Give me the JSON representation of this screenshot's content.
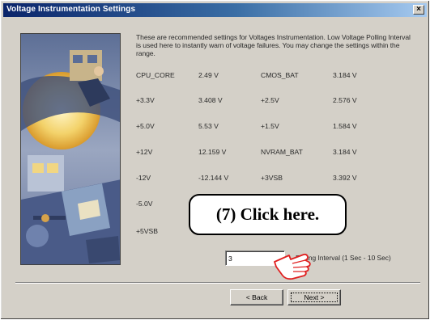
{
  "window": {
    "title": "Voltage Instrumentation Settings",
    "close_glyph": "×"
  },
  "description": "These are recommended settings for Voltages Instrumentation. Low Voltage Polling Interval is used here to instantly warn of voltage failures. You may change the settings within the range.",
  "readings": [
    {
      "left_label": "CPU_CORE",
      "left_value": "2.49 V",
      "right_label": "CMOS_BAT",
      "right_value": "3.184 V"
    },
    {
      "left_label": "+3.3V",
      "left_value": "3.408 V",
      "right_label": "+2.5V",
      "right_value": "2.576 V"
    },
    {
      "left_label": "+5.0V",
      "left_value": "5.53 V",
      "right_label": "+1.5V",
      "right_value": "1.584 V"
    },
    {
      "left_label": "+12V",
      "left_value": "12.159 V",
      "right_label": "NVRAM_BAT",
      "right_value": "3.184 V"
    },
    {
      "left_label": "-12V",
      "left_value": "-12.144 V",
      "right_label": "+3VSB",
      "right_value": "3.392 V"
    },
    {
      "left_label": "-5.0V",
      "left_value": "",
      "right_label": "",
      "right_value": ""
    },
    {
      "left_label": "+5VSB",
      "left_value": "",
      "right_label": "",
      "right_value": ""
    }
  ],
  "polling": {
    "value": "3",
    "label": "Polling Interval (1 Sec - 10 Sec)"
  },
  "buttons": {
    "back": "< Back",
    "next": "Next >"
  },
  "annotation": {
    "callout": "(7)  Click here."
  },
  "icons": {
    "close": "close-icon",
    "hand": "pointing-hand-icon"
  },
  "colors": {
    "title_start": "#0a246a",
    "title_end": "#a6caf0",
    "dialog": "#d4d0c8",
    "hand": "#e02020"
  }
}
